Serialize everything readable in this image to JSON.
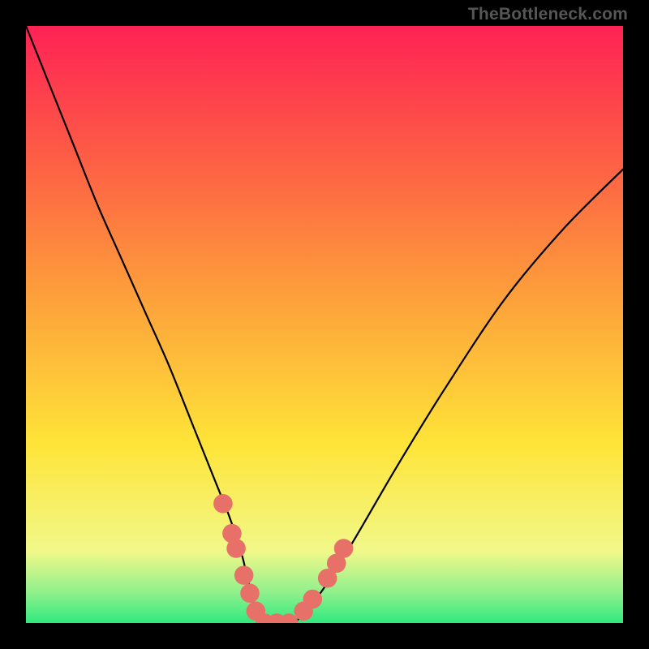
{
  "watermark": "TheBottleneck.com",
  "chart_data": {
    "type": "line",
    "title": "",
    "xlabel": "",
    "ylabel": "",
    "xlim": [
      0,
      100
    ],
    "ylim": [
      0,
      100
    ],
    "background_gradient": {
      "stops": [
        {
          "pos": 0,
          "color": "#2fe97f"
        },
        {
          "pos": 5,
          "color": "#8ef08c"
        },
        {
          "pos": 12,
          "color": "#f1f88a"
        },
        {
          "pos": 30,
          "color": "#fee438"
        },
        {
          "pos": 55,
          "color": "#fd9f3b"
        },
        {
          "pos": 78,
          "color": "#fd5d45"
        },
        {
          "pos": 100,
          "color": "#fe2255"
        }
      ]
    },
    "series": [
      {
        "name": "bottleneck-curve",
        "type": "spline",
        "stroke": "#000000",
        "x": [
          0,
          4,
          8,
          12,
          16,
          20,
          24,
          28,
          30,
          32,
          34,
          36,
          37,
          38,
          39,
          40,
          42,
          44,
          46,
          50,
          55,
          62,
          70,
          80,
          90,
          100
        ],
        "values": [
          100,
          90,
          80,
          70,
          61,
          52,
          43,
          33,
          28,
          23,
          18,
          12,
          8,
          4,
          1,
          0,
          0,
          0,
          1,
          6,
          14,
          26,
          39,
          54,
          66,
          76
        ]
      }
    ],
    "markers": {
      "color": "#e77169",
      "radius": 1.6,
      "points": [
        {
          "x": 33.0,
          "y": 20.0
        },
        {
          "x": 34.5,
          "y": 15.0
        },
        {
          "x": 35.2,
          "y": 12.5
        },
        {
          "x": 36.5,
          "y": 8.0
        },
        {
          "x": 37.5,
          "y": 5.0
        },
        {
          "x": 38.5,
          "y": 2.0
        },
        {
          "x": 40.0,
          "y": 0.0
        },
        {
          "x": 42.0,
          "y": 0.0
        },
        {
          "x": 44.0,
          "y": 0.0
        },
        {
          "x": 46.5,
          "y": 2.0
        },
        {
          "x": 48.0,
          "y": 4.0
        },
        {
          "x": 50.5,
          "y": 7.5
        },
        {
          "x": 52.0,
          "y": 10.0
        },
        {
          "x": 53.2,
          "y": 12.5
        }
      ]
    }
  }
}
